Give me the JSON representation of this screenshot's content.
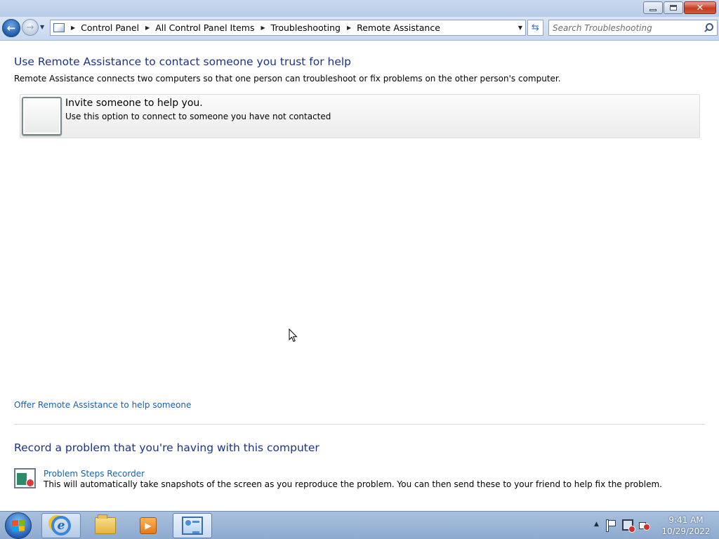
{
  "window": {
    "minimize_icon": "minimize-icon",
    "maximize_icon": "restore-icon",
    "close_icon": "close-icon"
  },
  "nav": {
    "back_icon": "back-arrow-icon",
    "forward_icon": "forward-arrow-icon",
    "breadcrumbs": [
      "Control Panel",
      "All Control Panel Items",
      "Troubleshooting",
      "Remote Assistance"
    ],
    "search_placeholder": "Search Troubleshooting"
  },
  "main": {
    "heading": "Use Remote Assistance to contact someone you trust for help",
    "description": "Remote Assistance connects two computers so that one person can troubleshoot or fix problems on the other person's computer.",
    "option": {
      "title": "Invite someone to help you.",
      "subtitle": "Use this option to connect to someone you have not contacted"
    },
    "offer_link": "Offer Remote Assistance to help someone",
    "record_heading": "Record a problem that you're having with this computer",
    "psr_link": "Problem Steps Recorder",
    "psr_description": "This will automatically take snapshots of the screen as you reproduce the problem. You can then send these to your friend to help fix the problem."
  },
  "taskbar": {
    "apps": [
      "internet-explorer-icon",
      "windows-explorer-icon",
      "media-player-icon",
      "control-panel-icon"
    ],
    "time": "9:41 AM",
    "date": "10/29/2022"
  }
}
